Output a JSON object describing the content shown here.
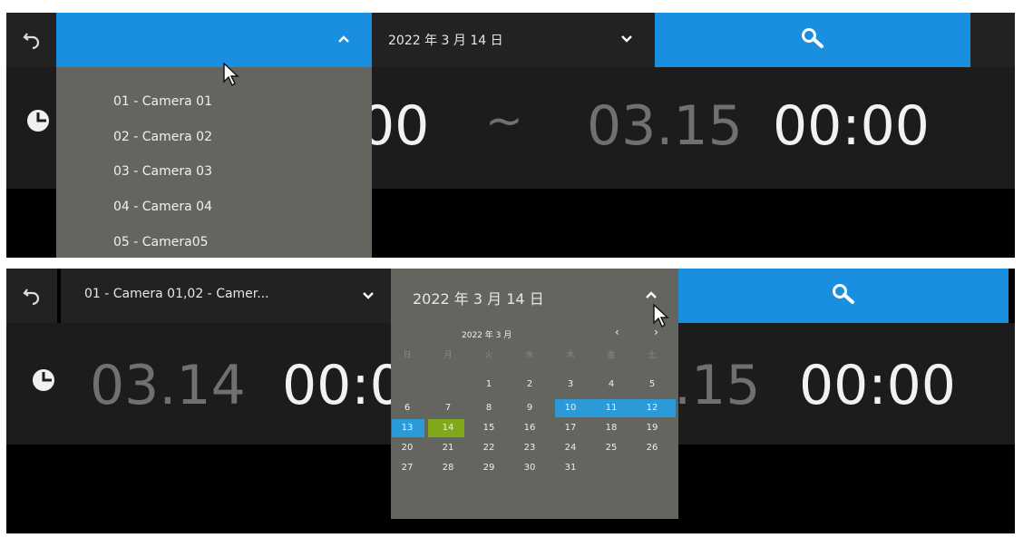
{
  "top": {
    "camera_selector": {
      "value": "",
      "expanded": true
    },
    "date_selector": {
      "value": "2022 年 3 月 14 日"
    },
    "camera_options": [
      "01 - Camera 01",
      "02 - Camera 02",
      "03 - Camera 03",
      "04 - Camera 04",
      "05 - Camera05"
    ],
    "time_range": {
      "start_time_partial": "00",
      "separator": "~",
      "end_date": "03.15",
      "end_time": "00:00"
    }
  },
  "bottom": {
    "camera_selector": {
      "value": "01 - Camera 01,02 - Camer..."
    },
    "date_selector": {
      "value": "2022 年 3 月 14 日",
      "expanded": true
    },
    "time_range": {
      "start_date": "03.14",
      "start_time_partial": "00:0",
      "end_date_partial": ".15",
      "end_time": "00:00"
    },
    "calendar": {
      "month_title": "2022 年 3 月",
      "prev": "‹",
      "next": "›",
      "weekdays": [
        "日",
        "月",
        "火",
        "水",
        "木",
        "金",
        "土"
      ],
      "weeks": [
        [
          "",
          "",
          "1",
          "2",
          "3",
          "4",
          "5"
        ],
        [
          "6",
          "7",
          "8",
          "9",
          "10",
          "11",
          "12"
        ],
        [
          "13",
          "14",
          "15",
          "16",
          "17",
          "18",
          "19"
        ],
        [
          "20",
          "21",
          "22",
          "23",
          "24",
          "25",
          "26"
        ],
        [
          "27",
          "28",
          "29",
          "30",
          "31",
          "",
          ""
        ]
      ],
      "range_highlight": [
        "10",
        "11",
        "12",
        "13"
      ],
      "selected_day": "14"
    }
  },
  "colors": {
    "accent_blue": "#1a8fe0",
    "range_blue": "#2d9ad8",
    "selected_green": "#7fa81a",
    "dropdown_bg": "#65655f"
  },
  "icons": {
    "back": "back-arrow-icon",
    "search": "search-icon",
    "clock": "clock-icon"
  }
}
